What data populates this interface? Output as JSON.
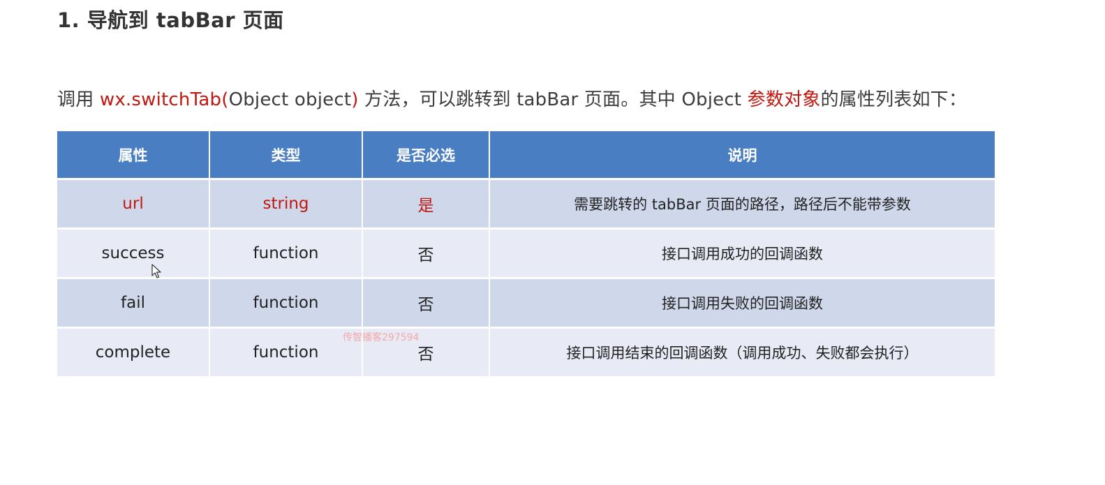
{
  "heading": "1. 导航到 tabBar 页面",
  "intro": {
    "prefix": "调用 ",
    "method": "wx.switchTab(",
    "param": "Object object",
    "close_paren": ")",
    "middle": " 方法，可以跳转到 tabBar 页面。其中 Object ",
    "highlight": "参数对象",
    "suffix": "的属性列表如下："
  },
  "table": {
    "headers": [
      "属性",
      "类型",
      "是否必选",
      "说明"
    ],
    "rows": [
      {
        "prop": "url",
        "type": "string",
        "required": "是",
        "desc": "需要跳转的 tabBar 页面的路径，路径后不能带参数"
      },
      {
        "prop": "success",
        "type": "function",
        "required": "否",
        "desc": "接口调用成功的回调函数"
      },
      {
        "prop": "fail",
        "type": "function",
        "required": "否",
        "desc": "接口调用失败的回调函数"
      },
      {
        "prop": "complete",
        "type": "function",
        "required": "否",
        "desc": "接口调用结束的回调函数（调用成功、失败都会执行）"
      }
    ]
  },
  "watermark": "传智播客297594",
  "icons": {
    "cursor": "mouse-pointer-icon"
  },
  "colors": {
    "accent_red": "#c0170f",
    "header_blue": "#4a7ec2",
    "row_odd": "#cfd8ea",
    "row_even": "#e8ebf5"
  }
}
